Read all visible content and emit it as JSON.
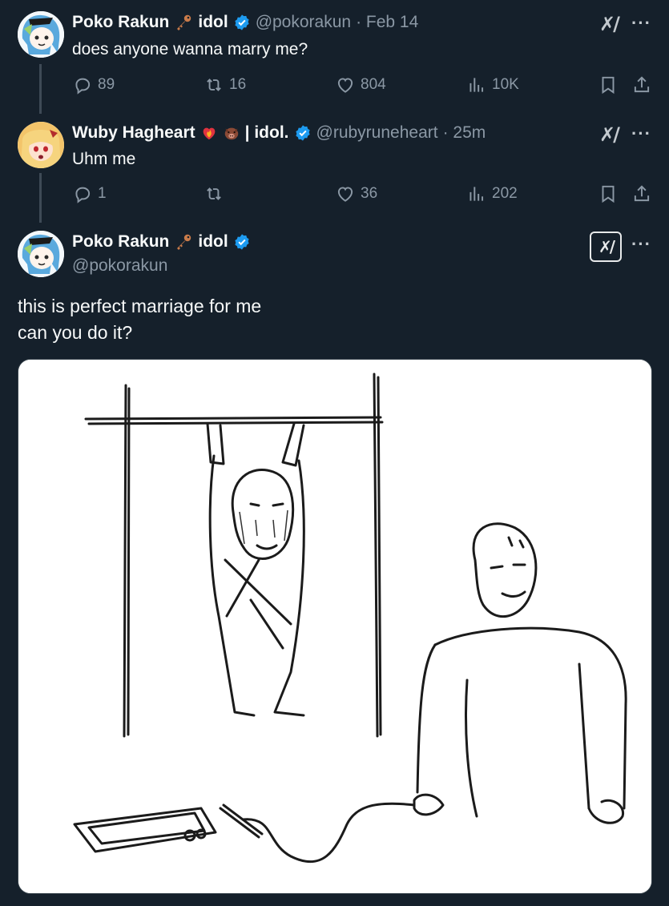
{
  "tweets": [
    {
      "name": "Poko Rakun",
      "name_suffix": "idol",
      "handle": "@pokorakun",
      "time": "· Feb 14",
      "text": "does anyone wanna marry me?",
      "stats": {
        "replies": "89",
        "reposts": "16",
        "likes": "804",
        "views": "10K"
      }
    },
    {
      "name": "Wuby Hagheart",
      "name_suffix": "| idol.",
      "handle": "@rubyruneheart",
      "time": "· 25m",
      "text": "Uhm me",
      "stats": {
        "replies": "1",
        "reposts": "",
        "likes": "36",
        "views": "202"
      }
    }
  ],
  "main_tweet": {
    "name": "Poko Rakun",
    "name_suffix": "idol",
    "handle": "@pokorakun",
    "lines": [
      "this is perfect marriage for me",
      "can you do it?"
    ]
  },
  "icons": {
    "reply": "reply-icon",
    "repost": "repost-icon",
    "like": "heart-icon",
    "views": "views-icon",
    "bookmark": "bookmark-icon",
    "share": "share-icon",
    "grok": "grok-icon",
    "more": "more-icon",
    "verified": "verified-badge-icon"
  },
  "colors": {
    "background": "#15202b",
    "text": "#f7f9f9",
    "muted": "#8b98a5",
    "verified": "#1d9bf0"
  }
}
